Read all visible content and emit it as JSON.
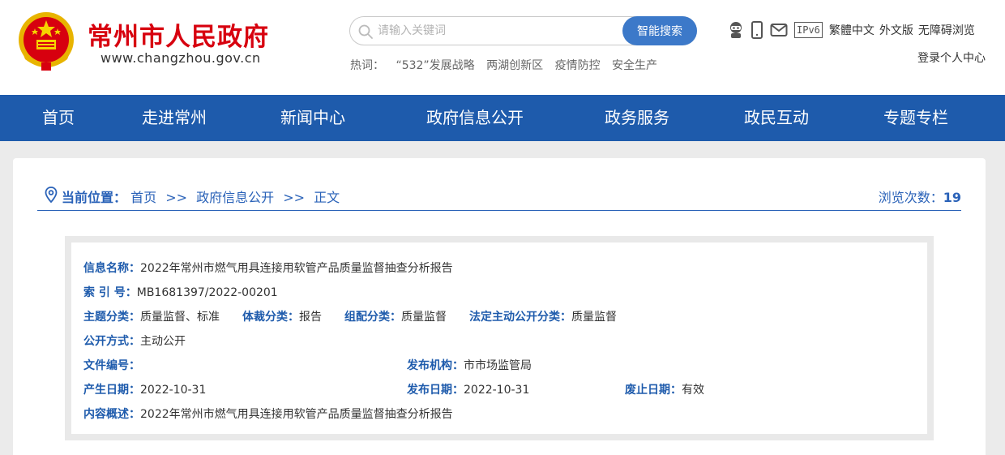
{
  "header": {
    "site_title": "常州市人民政府",
    "site_url": "www.changzhou.gov.cn",
    "search": {
      "placeholder": "请输入关键词",
      "button_label": "智能搜索"
    },
    "hotwords": {
      "label": "热词：",
      "items": [
        "“532”发展战略",
        "两湖创新区",
        "疫情防控",
        "安全生产"
      ]
    },
    "tools": {
      "icons": [
        "robot-icon",
        "mobile-icon",
        "mail-icon"
      ],
      "ipv6": "IPv6",
      "links": [
        "繁體中文",
        "外文版",
        "无障碍浏览"
      ]
    },
    "login_label": "登录个人中心"
  },
  "nav": {
    "items": [
      "首页",
      "走进常州",
      "新闻中心",
      "政府信息公开",
      "政务服务",
      "政民互动",
      "专题专栏"
    ]
  },
  "breadcrumb": {
    "lead": "当前位置：",
    "items": [
      "首页",
      "政府信息公开",
      "正文"
    ],
    "separator": ">>",
    "views_label": "浏览次数：",
    "views_count": "19"
  },
  "info": {
    "name_label": "信息名称：",
    "name_value": "2022年常州市燃气用具连接用软管产品质量监督抽查分析报告",
    "index_label": "索 引 号：",
    "index_value": "MB1681397/2022-00201",
    "topic_label": "主题分类：",
    "topic_value": "质量监督、标准",
    "genre_label": "体裁分类：",
    "genre_value": "报告",
    "org_class_label": "组配分类：",
    "org_class_value": "质量监督",
    "legal_label": "法定主动公开分类：",
    "legal_value": "质量监督",
    "method_label": "公开方式：",
    "method_value": "主动公开",
    "docno_label": "文件编号：",
    "docno_value": "",
    "publisher_label": "发布机构：",
    "publisher_value": "市市场监管局",
    "created_label": "产生日期：",
    "created_value": "2022-10-31",
    "published_label": "发布日期：",
    "published_value": "2022-10-31",
    "abolish_label": "废止日期：",
    "abolish_value": "有效",
    "summary_label": "内容概述：",
    "summary_value": "2022年常州市燃气用具连接用软管产品质量监督抽查分析报告"
  },
  "colors": {
    "brand_red": "#d7000f",
    "nav_blue": "#1e5bac",
    "search_blue": "#3c79c9",
    "label_blue": "#1e5bac"
  }
}
